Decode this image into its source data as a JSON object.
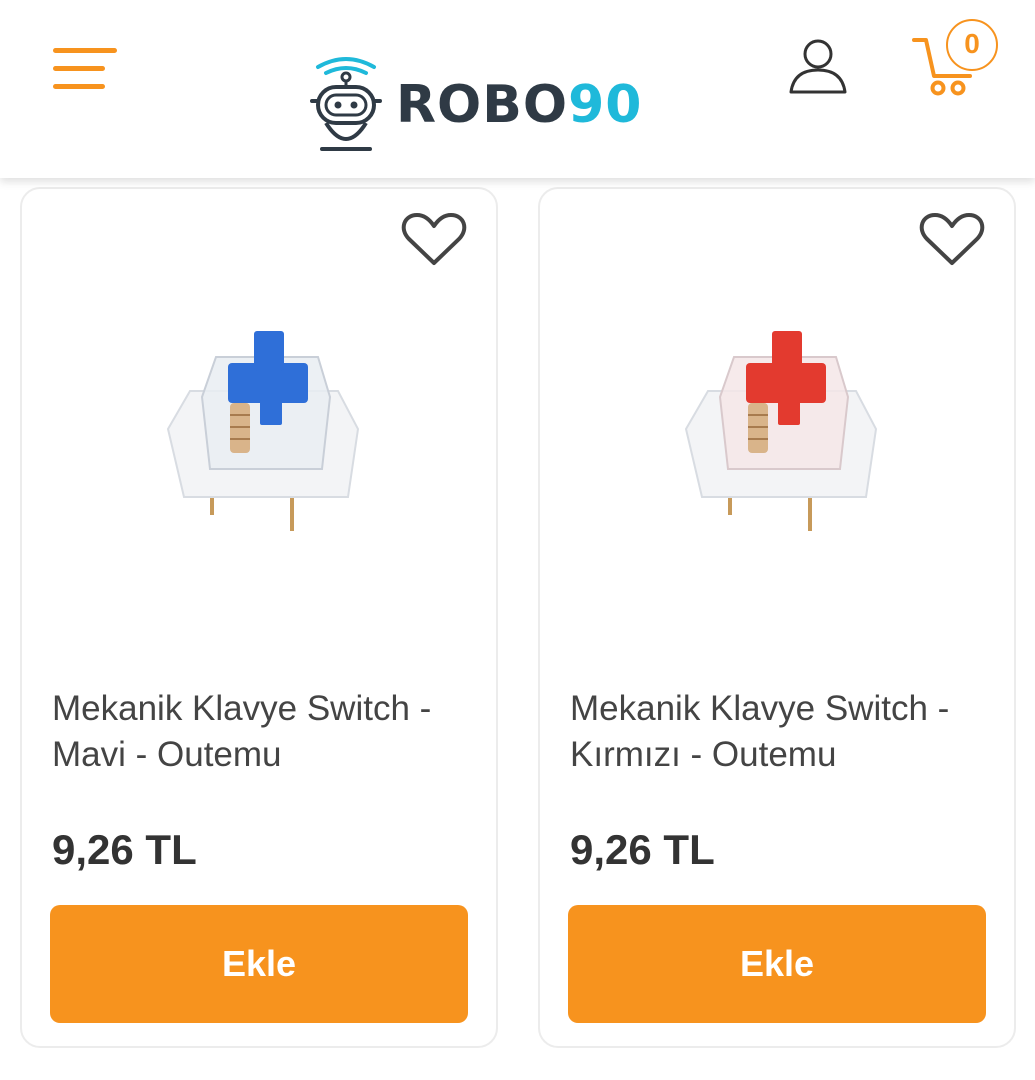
{
  "colors": {
    "accent": "#F7931E",
    "logo_dark": "#2F3A45",
    "logo_cyan": "#1FB9DA",
    "text": "#444444",
    "price": "#333333"
  },
  "header": {
    "menu_icon": "hamburger-menu-icon",
    "logo": {
      "text_main": "ROBO",
      "text_accent": "90"
    },
    "user_icon": "user-account-icon",
    "cart_icon": "shopping-cart-icon",
    "cart_count": "0"
  },
  "products": [
    {
      "name": "Mekanik Klavye Switch - Mavi - Outemu",
      "price": "9,26 TL",
      "add_label": "Ekle",
      "favorite_icon": "heart-icon",
      "stem_color": "#2F6FD8"
    },
    {
      "name": "Mekanik Klavye Switch - Kırmızı - Outemu",
      "price": "9,26 TL",
      "add_label": "Ekle",
      "favorite_icon": "heart-icon",
      "stem_color": "#E33A2F"
    }
  ]
}
